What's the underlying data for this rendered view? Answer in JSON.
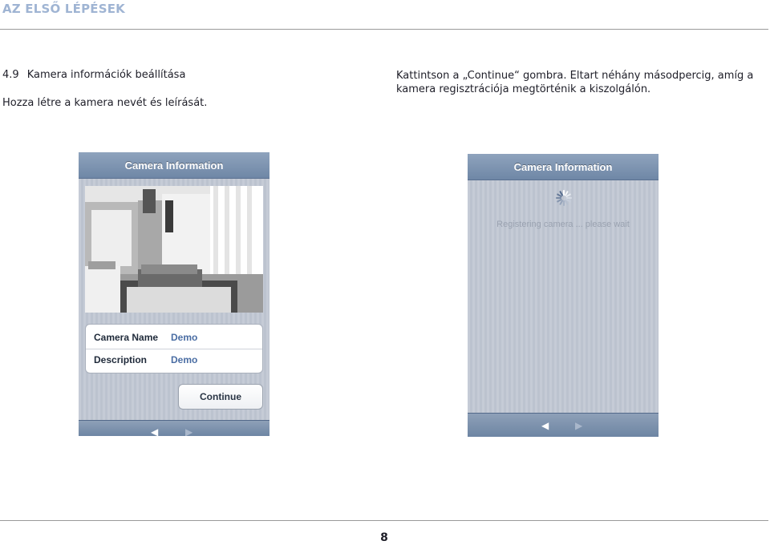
{
  "header": {
    "title": "AZ ELSŐ LÉPÉSEK"
  },
  "section": {
    "number": "4.9",
    "title": "Kamera információk beállítása",
    "left_description": "Hozza létre a kamera nevét és leírását.",
    "right_description": "Kattintson a „Continue“ gombra. Eltart néhány másodpercig, amíg a kamera regisztrációja megtörténik a kiszolgálón."
  },
  "screen_a": {
    "nav_title": "Camera Information",
    "fields": [
      {
        "label": "Camera Name",
        "value": "Demo"
      },
      {
        "label": "Description",
        "value": "Demo"
      }
    ],
    "continue_label": "Continue",
    "toolbar_icons": [
      "back-arrow-icon",
      "forward-arrow-icon"
    ]
  },
  "screen_b": {
    "nav_title": "Camera Information",
    "status_text": "Registering camera ... please wait",
    "loading_icon": "spinner-icon",
    "toolbar_icons": [
      "back-arrow-icon",
      "forward-arrow-icon"
    ]
  },
  "footer": {
    "page_number": "8"
  },
  "colors": {
    "header_accent": "#9fb4d3",
    "ios_nav_bar": "#7b90ad",
    "field_value": "#4a6da3"
  }
}
